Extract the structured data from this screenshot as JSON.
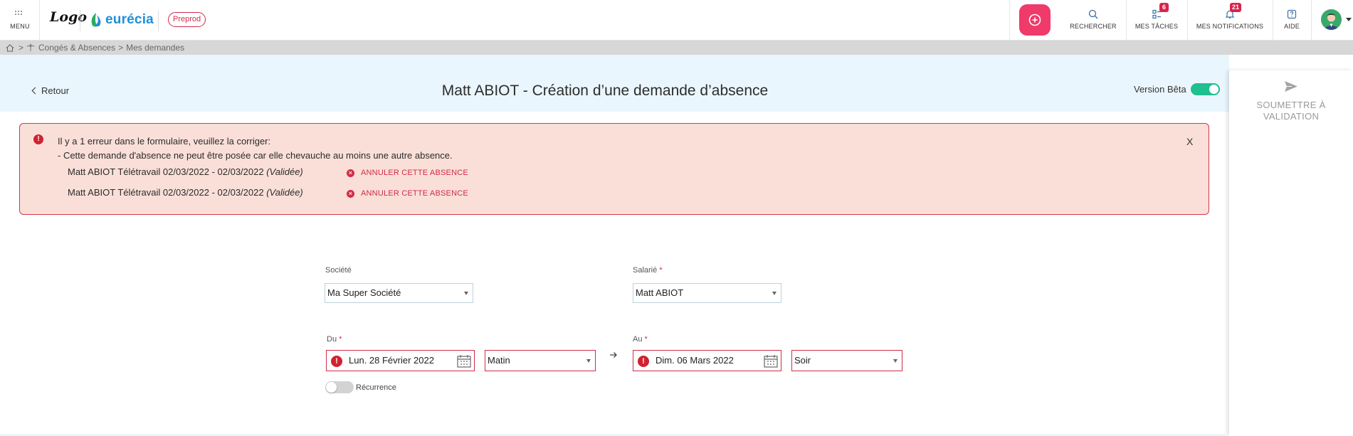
{
  "topbar": {
    "menu_label": "MENU",
    "logo_text": "Logo",
    "brand_name": "eurécia",
    "env_badge": "Preprod",
    "nav": [
      {
        "label": "RECHERCHER",
        "icon": "search-icon"
      },
      {
        "label": "MES TÂCHES",
        "icon": "tasks-icon",
        "badge": "6"
      },
      {
        "label": "MES NOTIFICATIONS",
        "icon": "bell-icon",
        "badge": "21"
      },
      {
        "label": "AIDE",
        "icon": "help-icon"
      }
    ],
    "colors": {
      "add_button": "#ef3a6a",
      "brand": "#1e8fd6",
      "badge": "#d8234c"
    }
  },
  "breadcrumb": {
    "sep1": ">",
    "section": "Congés & Absences",
    "sep2": ">",
    "page": "Mes demandes"
  },
  "header": {
    "back_label": "Retour",
    "title": "Matt ABIOT - Création d’une demande d’absence",
    "beta_label": "Version Bêta",
    "beta_enabled": true
  },
  "side_panel": {
    "submit_line1": "SOUMETTRE À",
    "submit_line2": "VALIDATION"
  },
  "error": {
    "line1": "Il y a 1 erreur dans le formulaire, veuillez la corriger:",
    "line2": "- Cette demande d'absence ne peut être posée car elle chevauche au moins une autre absence.",
    "conflicts": [
      {
        "text": "Matt ABIOT Télétravail 02/03/2022 - 02/03/2022",
        "status": "(Validée)",
        "action": "ANNULER CETTE ABSENCE"
      },
      {
        "text": "Matt ABIOT Télétravail 02/03/2022 - 02/03/2022",
        "status": "(Validée)",
        "action": "ANNULER CETTE ABSENCE"
      }
    ],
    "close_label": "X"
  },
  "form": {
    "company": {
      "label": "Société",
      "value": "Ma Super Société"
    },
    "employee": {
      "label": "Salarié",
      "required_mark": "*",
      "value": "Matt ABIOT"
    },
    "from": {
      "label": "Du",
      "required_mark": "*",
      "date": "Lun. 28 Février 2022",
      "period": "Matin"
    },
    "to": {
      "label": "Au",
      "required_mark": "*",
      "date": "Dim. 06 Mars 2022",
      "period": "Soir"
    },
    "recurrence_label": "Récurrence",
    "recurrence_enabled": false
  }
}
